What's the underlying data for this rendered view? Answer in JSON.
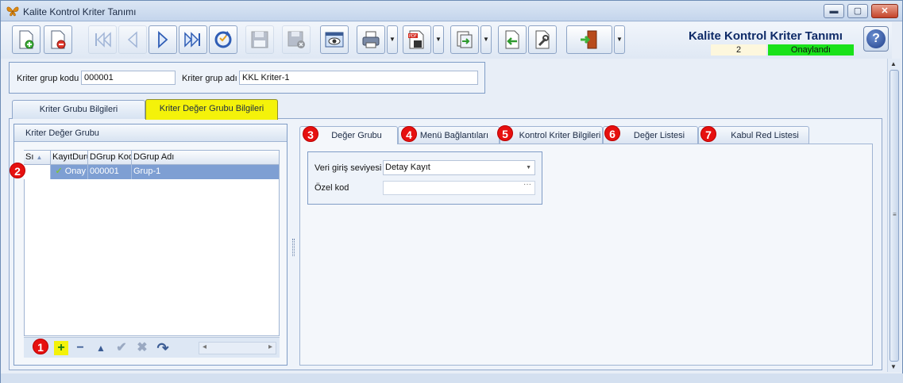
{
  "window": {
    "title": "Kalite Kontrol Kriter Tanımı",
    "minimize_symbol": "▬",
    "maximize_symbol": "▢",
    "close_symbol": "✕"
  },
  "header": {
    "title": "Kalite Kontrol Kriter Tanımı",
    "count": "2",
    "status": "Onaylandı",
    "status_color": "#19e21a",
    "help_symbol": "?"
  },
  "toolbar": {
    "buttons": [
      {
        "icon": "new-document-icon",
        "enabled": true
      },
      {
        "icon": "delete-document-icon",
        "enabled": true
      },
      {
        "icon": "first-record-icon",
        "enabled": false
      },
      {
        "icon": "previous-record-icon",
        "enabled": false
      },
      {
        "icon": "next-record-icon",
        "enabled": true
      },
      {
        "icon": "last-record-icon",
        "enabled": true
      },
      {
        "icon": "refresh-icon",
        "enabled": true
      },
      {
        "icon": "save-icon",
        "enabled": false
      },
      {
        "icon": "save-cancel-icon",
        "enabled": false
      },
      {
        "icon": "preview-icon",
        "enabled": true
      },
      {
        "icon": "print-icon",
        "enabled": true
      },
      {
        "icon": "pdf-export-icon",
        "enabled": true
      },
      {
        "icon": "export-icon",
        "enabled": true
      },
      {
        "icon": "import-icon",
        "enabled": true
      },
      {
        "icon": "tools-icon",
        "enabled": true
      },
      {
        "icon": "exit-icon",
        "enabled": true
      }
    ]
  },
  "criteria": {
    "code_label": "Kriter grup kodu",
    "code_value": "000001",
    "name_label": "Kriter grup adı",
    "name_value": "KKL Kriter-1"
  },
  "main_tabs": [
    {
      "label": "Kriter Grubu Bilgileri",
      "active": false
    },
    {
      "label": "Kriter Değer Grubu Bilgileri",
      "active": true
    }
  ],
  "value_group": {
    "title": "Kriter Değer Grubu",
    "columns": [
      "Sı",
      "KayıtDuru",
      "DGrup Kod",
      "DGrup Adı"
    ],
    "rows": [
      {
        "status": "Onay",
        "code": "000001",
        "name": "Grup-1"
      }
    ],
    "nav_symbols": {
      "add": "+",
      "remove": "−",
      "up": "▲",
      "confirm": "✔",
      "cancel": "✖",
      "redo": "↷",
      "scroll_left": "◂",
      "scroll_right": "▸"
    }
  },
  "markers": [
    "1",
    "2",
    "3",
    "4",
    "5",
    "6",
    "7"
  ],
  "sub_tabs": [
    {
      "label": "Değer Grubu",
      "active": true
    },
    {
      "label": "Menü Bağlantıları",
      "active": false
    },
    {
      "label": "Kontrol Kriter Bilgileri",
      "active": false
    },
    {
      "label": "Değer Listesi",
      "active": false
    },
    {
      "label": "Kabul Red Listesi",
      "active": false
    }
  ],
  "form": {
    "entry_level_label": "Veri giriş seviyesi",
    "entry_level_value": "Detay Kayıt",
    "special_code_label": "Özel kod",
    "special_code_value": ""
  },
  "colors": {
    "marker": "#e6100f",
    "active_tab": "#f4f20a",
    "selected_row": "#7e9fd3"
  }
}
